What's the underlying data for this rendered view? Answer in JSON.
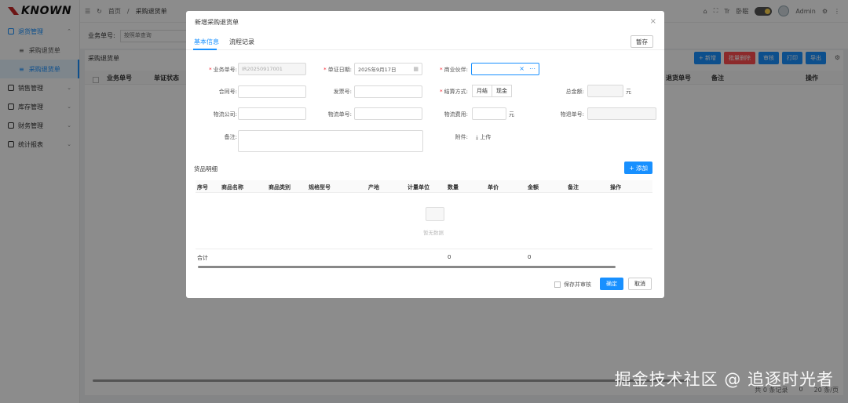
{
  "app": {
    "logo_text": "KNOWN"
  },
  "sidebar": {
    "groups": [
      {
        "label": "退货管理",
        "expanded": true
      },
      {
        "label": "销售管理"
      },
      {
        "label": "库存管理"
      },
      {
        "label": "财务管理"
      },
      {
        "label": "统计报表"
      }
    ],
    "subitems": [
      {
        "label": "采购退货单"
      },
      {
        "label": "采购退货单",
        "active": true
      }
    ]
  },
  "topbar": {
    "breadcrumb": [
      "首页",
      "采购退货单"
    ],
    "lang": "Tr",
    "mode_label": "卧眠",
    "user": "Admin"
  },
  "search": {
    "label": "业务单号:",
    "placeholder": "按照单查询"
  },
  "list": {
    "title": "采购退货单",
    "buttons": [
      {
        "label": "+ 新增",
        "color": "#1890ff"
      },
      {
        "label": "批量删除",
        "color": "#ff4d4f"
      },
      {
        "label": "审核",
        "color": "#1890ff"
      },
      {
        "label": "打印",
        "color": "#1890ff"
      },
      {
        "label": "导出",
        "color": "#1890ff"
      }
    ],
    "columns": [
      "业务单号",
      "单证状态",
      "退货单号",
      "备注",
      "操作"
    ],
    "pager": {
      "total": "共 0 条记录",
      "page": "0",
      "size": "20 条/页"
    }
  },
  "watermark": "掘金技术社区 @ 追逐时光者",
  "modal": {
    "title": "新增采购退货单",
    "close": "×",
    "tabs": [
      "基本信息",
      "流程记录"
    ],
    "save_draft": "暂存",
    "fields": {
      "biz_no_label": "业务单号:",
      "biz_no_value": "IR20250917001",
      "date_label": "单证日期:",
      "date_value": "2025年9月17日",
      "partner_label": "商业伙伴:",
      "contract_label": "合同号:",
      "invoice_label": "发票号:",
      "settle_label": "结算方式:",
      "settle_options": [
        "月结",
        "现金"
      ],
      "total_label": "总金额:",
      "total_unit": "元",
      "logistics_co_label": "物流公司:",
      "logistics_no_label": "物流单号:",
      "logistics_fee_label": "物流费用:",
      "logistics_fee_unit": "元",
      "return_no_label": "物退单号:",
      "remark_label": "备注:",
      "attach_label": "附件:",
      "upload_label": "上传"
    },
    "goods": {
      "title": "货品明细",
      "add_label": "+ 添加",
      "columns": [
        "序号",
        "商品名称",
        "商品类别",
        "规格型号",
        "产地",
        "计量单位",
        "数量",
        "单价",
        "金额",
        "备注",
        "操作"
      ],
      "empty_text": "暂无数据",
      "sum_label": "合计",
      "sum_qty": "0",
      "sum_amount": "0"
    },
    "footer": {
      "checkbox_label": "保存并审核",
      "ok": "确定",
      "cancel": "取消"
    }
  },
  "colors": {
    "primary": "#1890ff",
    "danger": "#ff4d4f",
    "required": "#f5222d"
  }
}
